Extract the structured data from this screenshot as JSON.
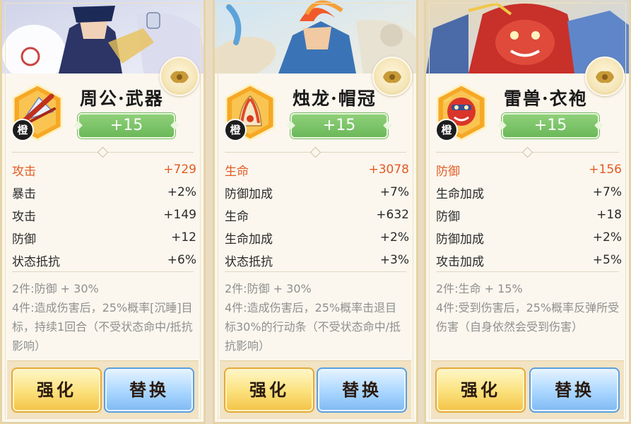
{
  "colors": {
    "accent_orange": "#e45a24",
    "level_green": "#7ec26a",
    "quality_orange": "#f2a024",
    "button_yellow": "#f7d35e",
    "button_blue": "#98c9f8"
  },
  "cards": [
    {
      "equip_name": "周公·武器",
      "quality": "橙",
      "level": "+15",
      "icon": "fan-weapon-icon",
      "main_stat": {
        "label": "攻击",
        "value": "+729"
      },
      "sub_stats": [
        {
          "label": "暴击",
          "value": "+2%"
        },
        {
          "label": "攻击",
          "value": "+149"
        },
        {
          "label": "防御",
          "value": "+12"
        },
        {
          "label": "状态抵抗",
          "value": "+6%"
        }
      ],
      "set_2": "2件:防御 + 30%",
      "set_4": "4件:造成伤害后，25%概率[沉睡]目标，持续1回合（不受状态命中/抵抗影响）",
      "enhance_label": "强化",
      "replace_label": "替换"
    },
    {
      "equip_name": "烛龙·帽冠",
      "quality": "橙",
      "level": "+15",
      "icon": "helmet-crown-icon",
      "main_stat": {
        "label": "生命",
        "value": "+3078"
      },
      "sub_stats": [
        {
          "label": "防御加成",
          "value": "+7%"
        },
        {
          "label": "生命",
          "value": "+632"
        },
        {
          "label": "生命加成",
          "value": "+2%"
        },
        {
          "label": "状态抵抗",
          "value": "+3%"
        }
      ],
      "set_2": "2件:防御 + 30%",
      "set_4": "4件:造成伤害后，25%概率击退目标30%的行动条（不受状态命中/抵抗影响）",
      "enhance_label": "强化",
      "replace_label": "替换"
    },
    {
      "equip_name": "雷兽·衣袍",
      "quality": "橙",
      "level": "+15",
      "icon": "beast-robe-icon",
      "main_stat": {
        "label": "防御",
        "value": "+156"
      },
      "sub_stats": [
        {
          "label": "生命加成",
          "value": "+7%"
        },
        {
          "label": "防御",
          "value": "+18"
        },
        {
          "label": "防御加成",
          "value": "+2%"
        },
        {
          "label": "攻击加成",
          "value": "+5%"
        }
      ],
      "set_2": "2件:生命 + 15%",
      "set_4": "4件:受到伤害后，25%概率反弹所受伤害（自身依然会受到伤害）",
      "enhance_label": "强化",
      "replace_label": "替换"
    }
  ]
}
